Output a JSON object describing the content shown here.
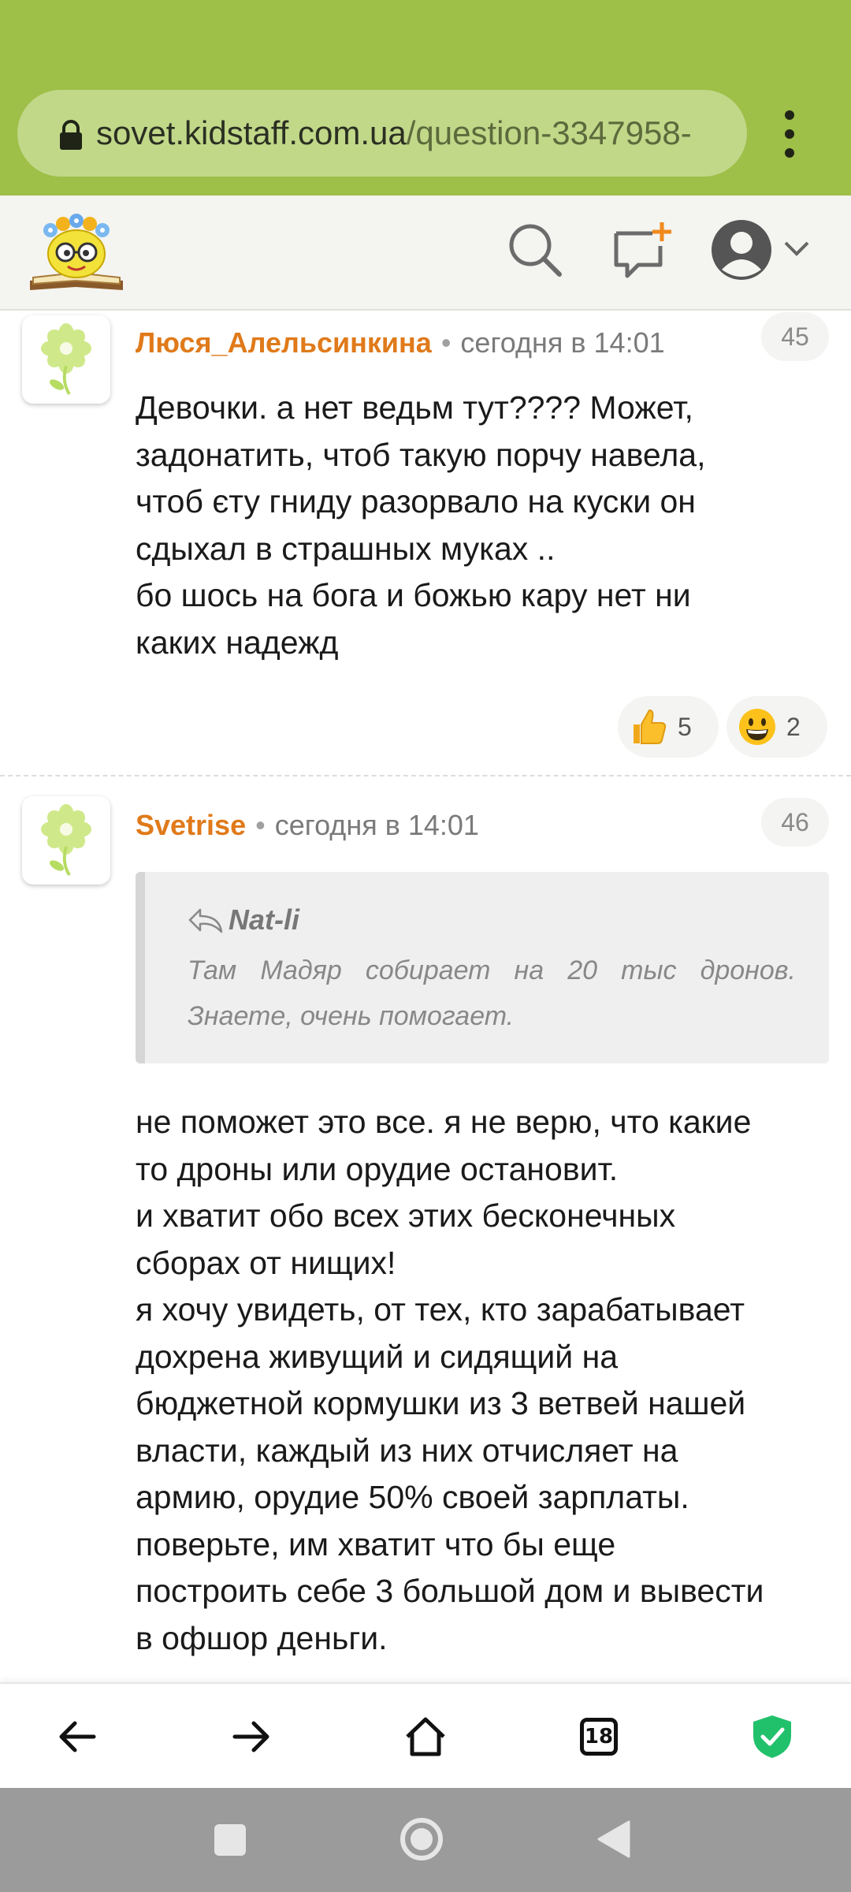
{
  "browser": {
    "url_domain": "sovet.kidstaff.com.ua",
    "url_path": "/question-3347958-",
    "open_tabs": "18"
  },
  "colors": {
    "chrome": "#9ebf48",
    "author": "#e07a1a",
    "shield": "#21c16b"
  },
  "header": {
    "icons": [
      "search-icon",
      "new-message-icon",
      "user-avatar-icon",
      "chevron-down-icon"
    ]
  },
  "comments": [
    {
      "author": "Люся_Алельсинкина",
      "time": "сегодня в 14:01",
      "number": "45",
      "text": "Девочки. а нет ведьм тут???? Может,\nзадонатить, чтоб такую порчу навела,\nчтоб єту гниду разорвало на куски он\nсдыхал в страшных муках ..\nбо шось на бога и божью кару нет ни\nкаких надежд",
      "reactions": [
        {
          "icon": "thumbs-up-icon",
          "count": "5"
        },
        {
          "icon": "grinning-face-icon",
          "count": "2"
        }
      ]
    },
    {
      "author": "Svetrise",
      "time": "сегодня в 14:01",
      "number": "46",
      "quote": {
        "author": "Nat-li",
        "text": "Там Мадяр собирает на 20 тыс дронов. Знаете, очень помогает."
      },
      "text": "не поможет это все. я не верю, что какие\nто дроны или орудие остановит.\nи хватит обо всех этих бесконечных\nсборах от нищих!\nя хочу увидеть, от тех, кто зарабатывает\nдохрена живущий и сидящий на\nбюджетной кормушки из 3 ветвей нашей\nвласти, каждый из них отчисляет на\nармию, орудие 50% своей зарплаты.\nповерьте, им хватит что бы еще\nпостроить себе 3 большой дом и вывести\nв офшор деньги."
    }
  ]
}
